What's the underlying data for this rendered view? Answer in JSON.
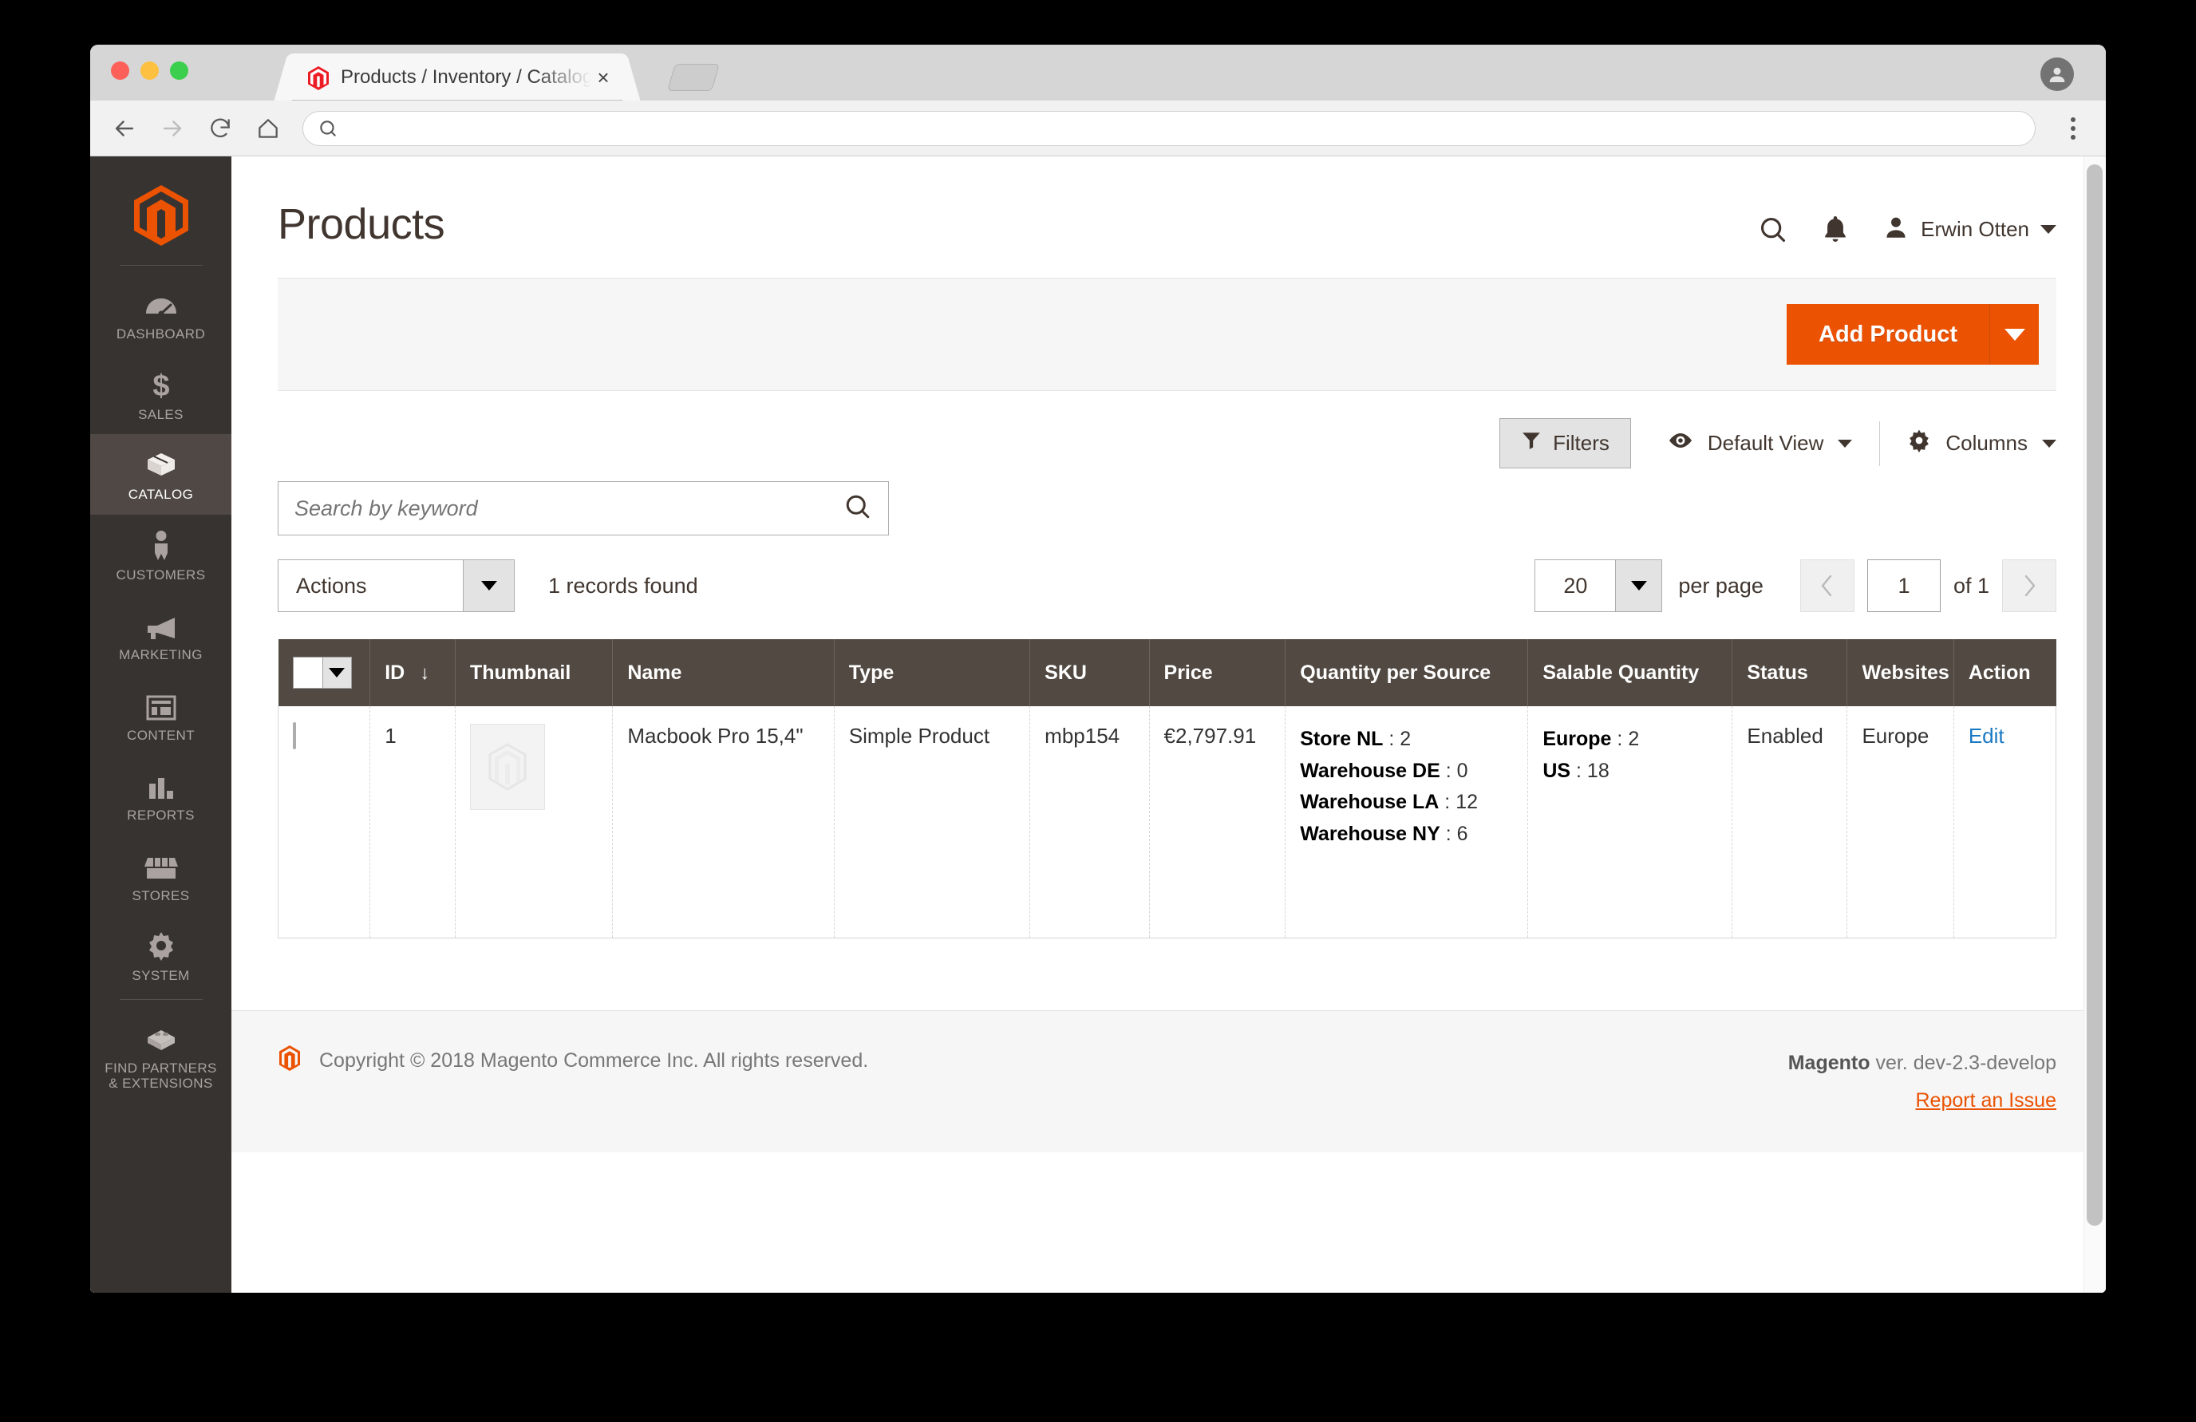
{
  "browser": {
    "tab": {
      "title": "Products / Inventory / Catalog",
      "close_label": "×",
      "favicon": "magento-icon"
    },
    "newtab_label": "",
    "omnibox": {
      "value": "",
      "placeholder": ""
    },
    "nav": {
      "back": "←",
      "forward": "→",
      "reload": "↻",
      "home": "⌂"
    }
  },
  "sidebar": {
    "logo": "magento-logo",
    "items": [
      {
        "label": "DASHBOARD",
        "icon": "dashboard-gauge-icon",
        "active": false
      },
      {
        "label": "SALES",
        "icon": "dollar-sign-icon",
        "active": false
      },
      {
        "label": "CATALOG",
        "icon": "box-icon",
        "active": true
      },
      {
        "label": "CUSTOMERS",
        "icon": "person-icon",
        "active": false
      },
      {
        "label": "MARKETING",
        "icon": "megaphone-icon",
        "active": false
      },
      {
        "label": "CONTENT",
        "icon": "layout-icon",
        "active": false
      },
      {
        "label": "REPORTS",
        "icon": "bar-chart-icon",
        "active": false
      },
      {
        "label": "STORES",
        "icon": "storefront-icon",
        "active": false
      },
      {
        "label": "SYSTEM",
        "icon": "gear-icon",
        "active": false
      },
      {
        "label": "FIND PARTNERS\n& EXTENSIONS",
        "icon": "extensions-icon",
        "active": false
      }
    ]
  },
  "header": {
    "title": "Products",
    "search_icon": "search-icon",
    "notifications_icon": "bell-icon",
    "user": {
      "name": "Erwin Otten",
      "avatar_icon": "user-avatar-icon"
    }
  },
  "actions_band": {
    "add_product_label": "Add Product",
    "add_product_toggle_icon": "caret-down-icon"
  },
  "grid_toolbar": {
    "filters_label": "Filters",
    "filters_icon": "funnel-icon",
    "view_label": "Default View",
    "view_icon": "eye-icon",
    "columns_label": "Columns",
    "columns_icon": "gear-icon"
  },
  "search": {
    "placeholder": "Search by keyword",
    "value": "",
    "icon": "search-icon"
  },
  "pager": {
    "actions_label": "Actions",
    "records_found": "1 records found",
    "per_page_value": "20",
    "per_page_label": "per page",
    "prev_icon": "chevron-left-icon",
    "page_value": "1",
    "of_label": "of 1",
    "next_icon": "chevron-right-icon"
  },
  "grid": {
    "select_all_icon": "checkbox-dropdown",
    "sort_icon": "↓",
    "columns": [
      "ID",
      "Thumbnail",
      "Name",
      "Type",
      "SKU",
      "Price",
      "Quantity per Source",
      "Salable Quantity",
      "Status",
      "Websites",
      "Action"
    ],
    "rows": [
      {
        "checked": false,
        "id": "1",
        "thumbnail": "magento-placeholder-thumbnail",
        "name": "Macbook Pro 15,4\"",
        "type": "Simple Product",
        "sku": "mbp154",
        "price": "€2,797.91",
        "quantity_per_source": [
          {
            "source": "Store NL",
            "qty": "2"
          },
          {
            "source": "Warehouse DE",
            "qty": "0"
          },
          {
            "source": "Warehouse LA",
            "qty": "12"
          },
          {
            "source": "Warehouse NY",
            "qty": "6"
          }
        ],
        "salable_quantity": [
          {
            "stock": "Europe",
            "qty": "2"
          },
          {
            "stock": "US",
            "qty": "18"
          }
        ],
        "status": "Enabled",
        "websites": "Europe",
        "action": "Edit"
      }
    ]
  },
  "footer": {
    "copyright": "Copyright © 2018 Magento Commerce Inc. All rights reserved.",
    "brand": "Magento",
    "version": " ver. dev-2.3-develop",
    "report_link": "Report an Issue"
  },
  "colors": {
    "accent_orange": "#eb5202",
    "sidebar_bg": "#373330",
    "sidebar_active": "#4f4844",
    "grid_header_bg": "#514942",
    "link_blue": "#1979c3"
  }
}
